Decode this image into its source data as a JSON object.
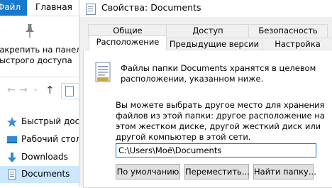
{
  "explorer": {
    "tabs": {
      "file": "Файл",
      "home": "Главная"
    },
    "ribbon": {
      "pin_line1": "Закрепить на панели",
      "pin_line2": "быстрого доступа"
    },
    "sidebar": [
      {
        "label": "Быстрый доступ",
        "icon": "star-icon"
      },
      {
        "label": "Рабочий стол",
        "icon": "desktop-icon"
      },
      {
        "label": "Downloads",
        "icon": "download-icon"
      },
      {
        "label": "Documents",
        "icon": "documents-icon"
      }
    ]
  },
  "dialog": {
    "title": "Свойства: Documents",
    "tabs_row1": [
      "Общие",
      "Доступ",
      "Безопасность"
    ],
    "tabs_row2": [
      "Расположение",
      "Предыдущие версии",
      "Настройка"
    ],
    "active_tab": "Расположение",
    "info": "Файлы папки Documents хранятся в целевом расположении, указанном ниже.",
    "description": "Вы можете выбрать другое место для хранения файлов из этой папки: другое расположение на этом жестком диске, другой жесткий диск или другой компьютер в этой сети.",
    "path_value": "C:\\Users\\Моё\\Documents",
    "buttons": {
      "default": "По умолчанию",
      "move": "Переместить...",
      "find": "Найти папку..."
    }
  }
}
